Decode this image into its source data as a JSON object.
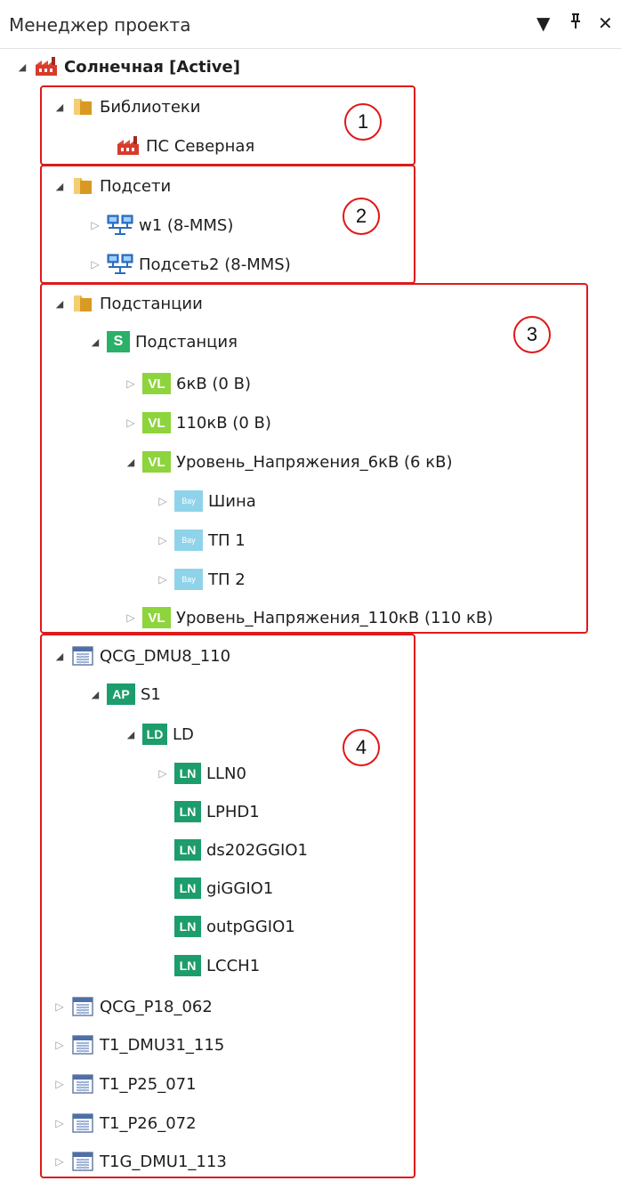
{
  "panel": {
    "title": "Менеджер проекта",
    "controls": {
      "dropdown": "▼",
      "pin": "ᵖ",
      "close": "✕"
    }
  },
  "tree": [
    {
      "label": "Солнечная [Active]",
      "icon": "factory-icon",
      "arrow": "expanded",
      "bold": true
    },
    {
      "label": "Библиотеки",
      "icon": "folder-icon",
      "arrow": "expanded"
    },
    {
      "label": "ПС Северная",
      "icon": "factory-icon",
      "arrow": "none"
    },
    {
      "label": "Подсети",
      "icon": "folder-icon",
      "arrow": "expanded"
    },
    {
      "label": "w1 (8-MMS)",
      "icon": "network-icon",
      "arrow": "collapsed"
    },
    {
      "label": "Подсеть2 (8-MMS)",
      "icon": "network-icon",
      "arrow": "collapsed"
    },
    {
      "label": "Подстанции",
      "icon": "folder-icon",
      "arrow": "expanded"
    },
    {
      "label": "Подстанция",
      "icon": "substation-icon",
      "badge": "S",
      "arrow": "expanded"
    },
    {
      "label": "6кВ (0 В)",
      "icon": "voltage-level-icon",
      "badge": "VL",
      "arrow": "collapsed"
    },
    {
      "label": "110кВ (0 В)",
      "icon": "voltage-level-icon",
      "badge": "VL",
      "arrow": "collapsed"
    },
    {
      "label": "Уровень_Напряжения_6кВ (6 кВ)",
      "icon": "voltage-level-icon",
      "badge": "VL",
      "arrow": "expanded"
    },
    {
      "label": "Шина",
      "icon": "bay-icon",
      "badge": "Bay",
      "arrow": "collapsed"
    },
    {
      "label": "ТП 1",
      "icon": "bay-icon",
      "badge": "Bay",
      "arrow": "collapsed"
    },
    {
      "label": "ТП 2",
      "icon": "bay-icon",
      "badge": "Bay",
      "arrow": "collapsed"
    },
    {
      "label": "Уровень_Напряжения_110кВ (110 кВ)",
      "icon": "voltage-level-icon",
      "badge": "VL",
      "arrow": "collapsed"
    },
    {
      "label": "QCG_DMU8_110",
      "icon": "ied-icon",
      "arrow": "expanded"
    },
    {
      "label": "S1",
      "icon": "access-point-icon",
      "badge": "AP",
      "arrow": "expanded"
    },
    {
      "label": "LD",
      "icon": "logical-device-icon",
      "badge": "LD",
      "arrow": "expanded"
    },
    {
      "label": "LLN0",
      "icon": "logical-node-icon",
      "badge": "LN",
      "arrow": "collapsed"
    },
    {
      "label": "LPHD1",
      "icon": "logical-node-icon",
      "badge": "LN",
      "arrow": "none"
    },
    {
      "label": "ds202GGIO1",
      "icon": "logical-node-icon",
      "badge": "LN",
      "arrow": "none"
    },
    {
      "label": "giGGIO1",
      "icon": "logical-node-icon",
      "badge": "LN",
      "arrow": "none"
    },
    {
      "label": "outpGGIO1",
      "icon": "logical-node-icon",
      "badge": "LN",
      "arrow": "none"
    },
    {
      "label": "LCCH1",
      "icon": "logical-node-icon",
      "badge": "LN",
      "arrow": "none"
    },
    {
      "label": "QCG_P18_062",
      "icon": "ied-icon",
      "arrow": "collapsed"
    },
    {
      "label": "T1_DMU31_115",
      "icon": "ied-icon",
      "arrow": "collapsed"
    },
    {
      "label": "T1_P25_071",
      "icon": "ied-icon",
      "arrow": "collapsed"
    },
    {
      "label": "T1_P26_072",
      "icon": "ied-icon",
      "arrow": "collapsed"
    },
    {
      "label": "T1G_DMU1_113",
      "icon": "ied-icon",
      "arrow": "collapsed"
    }
  ],
  "callouts": [
    "1",
    "2",
    "3",
    "4"
  ],
  "colors": {
    "highlight_box": "#e01818",
    "substation_badge": "#2bb06a",
    "voltage_badge": "#8ed43c",
    "bay_badge": "#8fd3ea",
    "ied_node_badge": "#1d9d6c",
    "folder": "#e8b23c",
    "factory": "#d93a2b"
  }
}
